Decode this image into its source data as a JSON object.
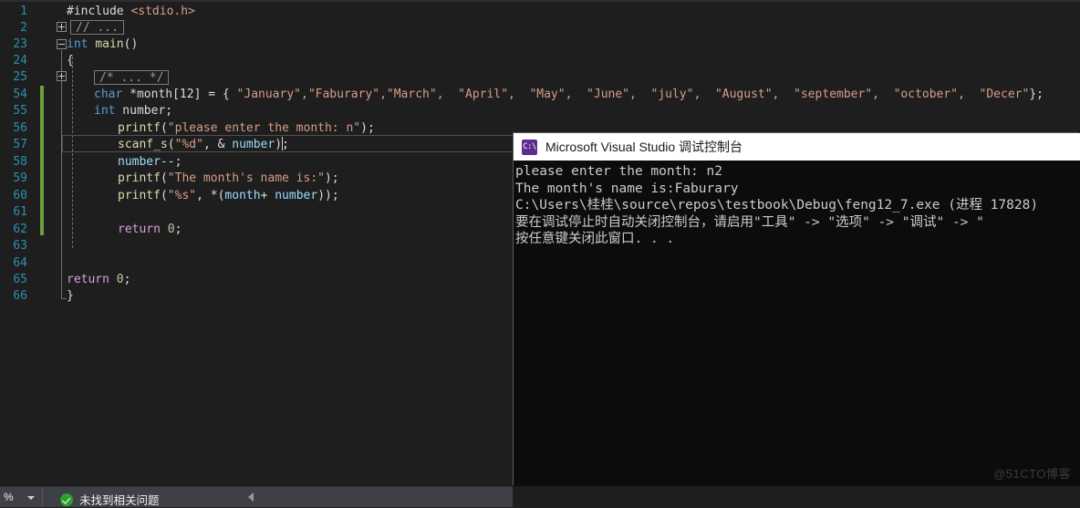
{
  "editor": {
    "background": "#1e1e1e",
    "linenumber_color": "#2b91af",
    "change_bar_color": "#6d9e3f",
    "collapsed_regions": [
      {
        "label": "// ...",
        "line": "2"
      },
      {
        "label": "/* ... */",
        "line": "25"
      }
    ],
    "lines": [
      {
        "no": "1",
        "indent": 0
      },
      {
        "no": "2",
        "indent": 0
      },
      {
        "no": "23",
        "indent": 0
      },
      {
        "no": "24",
        "indent": 0
      },
      {
        "no": "25",
        "indent": 0
      },
      {
        "no": "54",
        "indent": 0
      },
      {
        "no": "55",
        "indent": 0
      },
      {
        "no": "56",
        "indent": 0
      },
      {
        "no": "57",
        "indent": 0
      },
      {
        "no": "58",
        "indent": 0
      },
      {
        "no": "59",
        "indent": 0
      },
      {
        "no": "60",
        "indent": 0
      },
      {
        "no": "61",
        "indent": 0
      },
      {
        "no": "62",
        "indent": 0
      },
      {
        "no": "63",
        "indent": 0
      },
      {
        "no": "64",
        "indent": 0
      },
      {
        "no": "65",
        "indent": 0
      },
      {
        "no": "66",
        "indent": 0
      }
    ],
    "code": {
      "l1_include": "#include",
      "l1_header": "<stdio.h>",
      "l23_type": "int",
      "l23_name": "main",
      "l23_parens": "()",
      "l24_brace": "{",
      "l54_type": "char",
      "l54_decl": " *month[12] = { ",
      "l54_strings": "\"January\",\"Faburary\",\"March\",  \"April\",  \"May\",  \"June\",  \"july\",  \"August\",  \"september\",  \"october\",  \"Decer\"",
      "l54_tail": "};",
      "l55_type": "int",
      "l55_rest": " number;",
      "l56_func": "printf",
      "l56_open": "(",
      "l56_str": "\"please enter the month: n\"",
      "l56_close": ");",
      "l57_func": "scanf_s",
      "l57_open": "(",
      "l57_str": "\"%d\"",
      "l57_mid": ", & ",
      "l57_var": "number",
      "l57_close": ");",
      "l58_var": "number",
      "l58_rest": "--;",
      "l59_func": "printf",
      "l59_open": "(",
      "l59_str": "\"The month's name is:\"",
      "l59_close": ");",
      "l60_func": "printf",
      "l60_open": "(",
      "l60_str": "\"%s\"",
      "l60_mid": ", *(",
      "l60_var1": "month",
      "l60_plus": "+ ",
      "l60_var2": "number",
      "l60_close": "));",
      "l62_ctrl": "return",
      "l62_num": " 0",
      "l62_semi": ";",
      "l65_ctrl": "return",
      "l65_num": " 0",
      "l65_semi": ";",
      "l66_brace": "}"
    }
  },
  "console": {
    "title": "Microsoft Visual Studio 调试控制台",
    "icon_text": "C:\\",
    "icon_color": "#5c2d91",
    "background": "#0c0c0c",
    "text_color": "#cccccc",
    "lines": [
      "please enter the month: n2",
      "The month's name is:Faburary",
      "C:\\Users\\桂桂\\source\\repos\\testbook\\Debug\\feng12_7.exe (进程 17828)",
      "要在调试停止时自动关闭控制台，请启用\"工具\" -> \"选项\" -> \"调试\" -> \"",
      "按任意键关闭此窗口. . ."
    ]
  },
  "statusbar": {
    "zoom_value": "%",
    "problem_status": "未找到相关问题"
  },
  "watermark": {
    "text": "@51CTO博客"
  }
}
